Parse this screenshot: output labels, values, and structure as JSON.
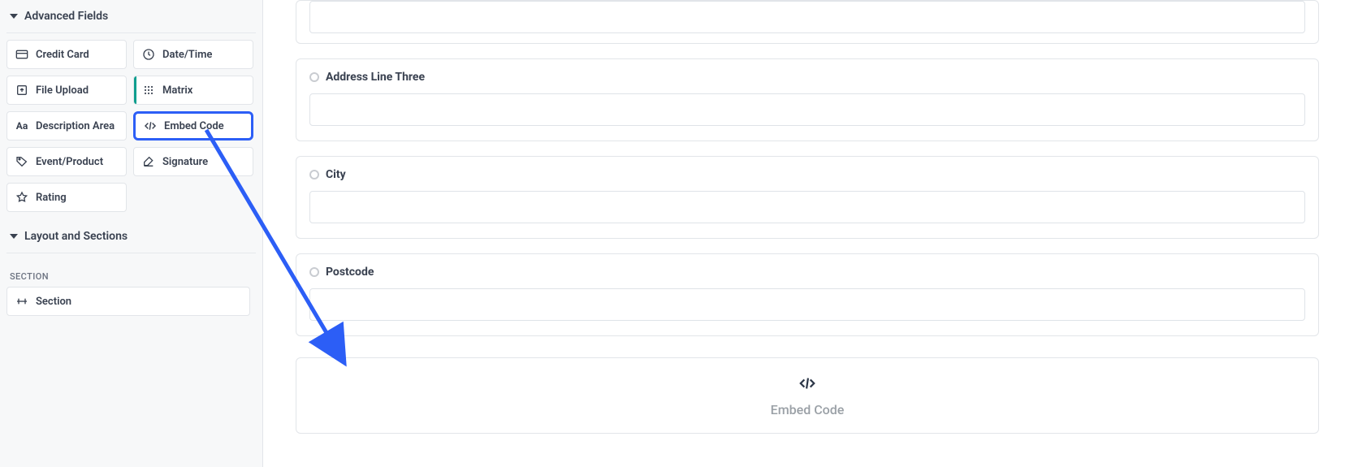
{
  "sidebar": {
    "advanced_header": "Advanced Fields",
    "fields": {
      "credit_card": "Credit Card",
      "date_time": "Date/Time",
      "file_upload": "File Upload",
      "matrix": "Matrix",
      "description_area": "Description Area",
      "embed_code": "Embed Code",
      "event_product": "Event/Product",
      "signature": "Signature",
      "rating": "Rating"
    },
    "layout_header": "Layout and Sections",
    "section_label": "SECTION",
    "section_item": "Section"
  },
  "form": {
    "address_three": "Address Line Three",
    "city": "City",
    "postcode": "Postcode"
  },
  "embed": {
    "label": "Embed Code"
  }
}
